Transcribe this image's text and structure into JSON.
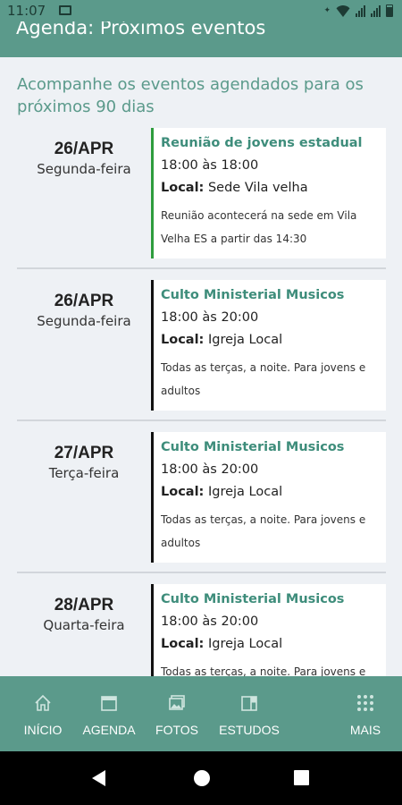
{
  "status_bar": {
    "time": "11:07"
  },
  "app_bar": {
    "title": "Agenda: Próximos eventos"
  },
  "subtitle": "Acompanhe os eventos agendados para os próximos 90 dias",
  "events": [
    {
      "date": "26/APR",
      "weekday": "Segunda-feira",
      "title": "Reunião de jovens estadual",
      "time": "18:00 às 18:00",
      "local_label": "Local:",
      "local": "Sede Vila velha",
      "description": "Reunião acontecerá na sede em Vila Velha ES a partir das 14:30",
      "accent": "#2e9c3d"
    },
    {
      "date": "26/APR",
      "weekday": "Segunda-feira",
      "title": "Culto Ministerial Musicos",
      "time": "18:00 às 20:00",
      "local_label": "Local:",
      "local": "Igreja Local",
      "description": "Todas as terças, a noite. Para jovens e adultos",
      "accent": "#111111"
    },
    {
      "date": "27/APR",
      "weekday": "Terça-feira",
      "title": "Culto Ministerial Musicos",
      "time": "18:00 às 20:00",
      "local_label": "Local:",
      "local": "Igreja Local",
      "description": "Todas as terças, a noite. Para jovens e adultos",
      "accent": "#111111"
    },
    {
      "date": "28/APR",
      "weekday": "Quarta-feira",
      "title": "Culto Ministerial Musicos",
      "time": "18:00 às 20:00",
      "local_label": "Local:",
      "local": "Igreja Local",
      "description": "Todas as terças, a noite. Para jovens e adultos",
      "accent": "#111111"
    }
  ],
  "bottom_nav": [
    {
      "label": "INÍCIO",
      "icon": "home-icon"
    },
    {
      "label": "AGENDA",
      "icon": "calendar-icon"
    },
    {
      "label": "FOTOS",
      "icon": "photos-icon"
    },
    {
      "label": "ESTUDOS",
      "icon": "book-icon"
    },
    {
      "label": "MAIS",
      "icon": "grid-icon"
    }
  ],
  "colors": {
    "primary": "#5b9a8b",
    "title_text": "#3e8d7b",
    "background": "#eef1f5"
  }
}
